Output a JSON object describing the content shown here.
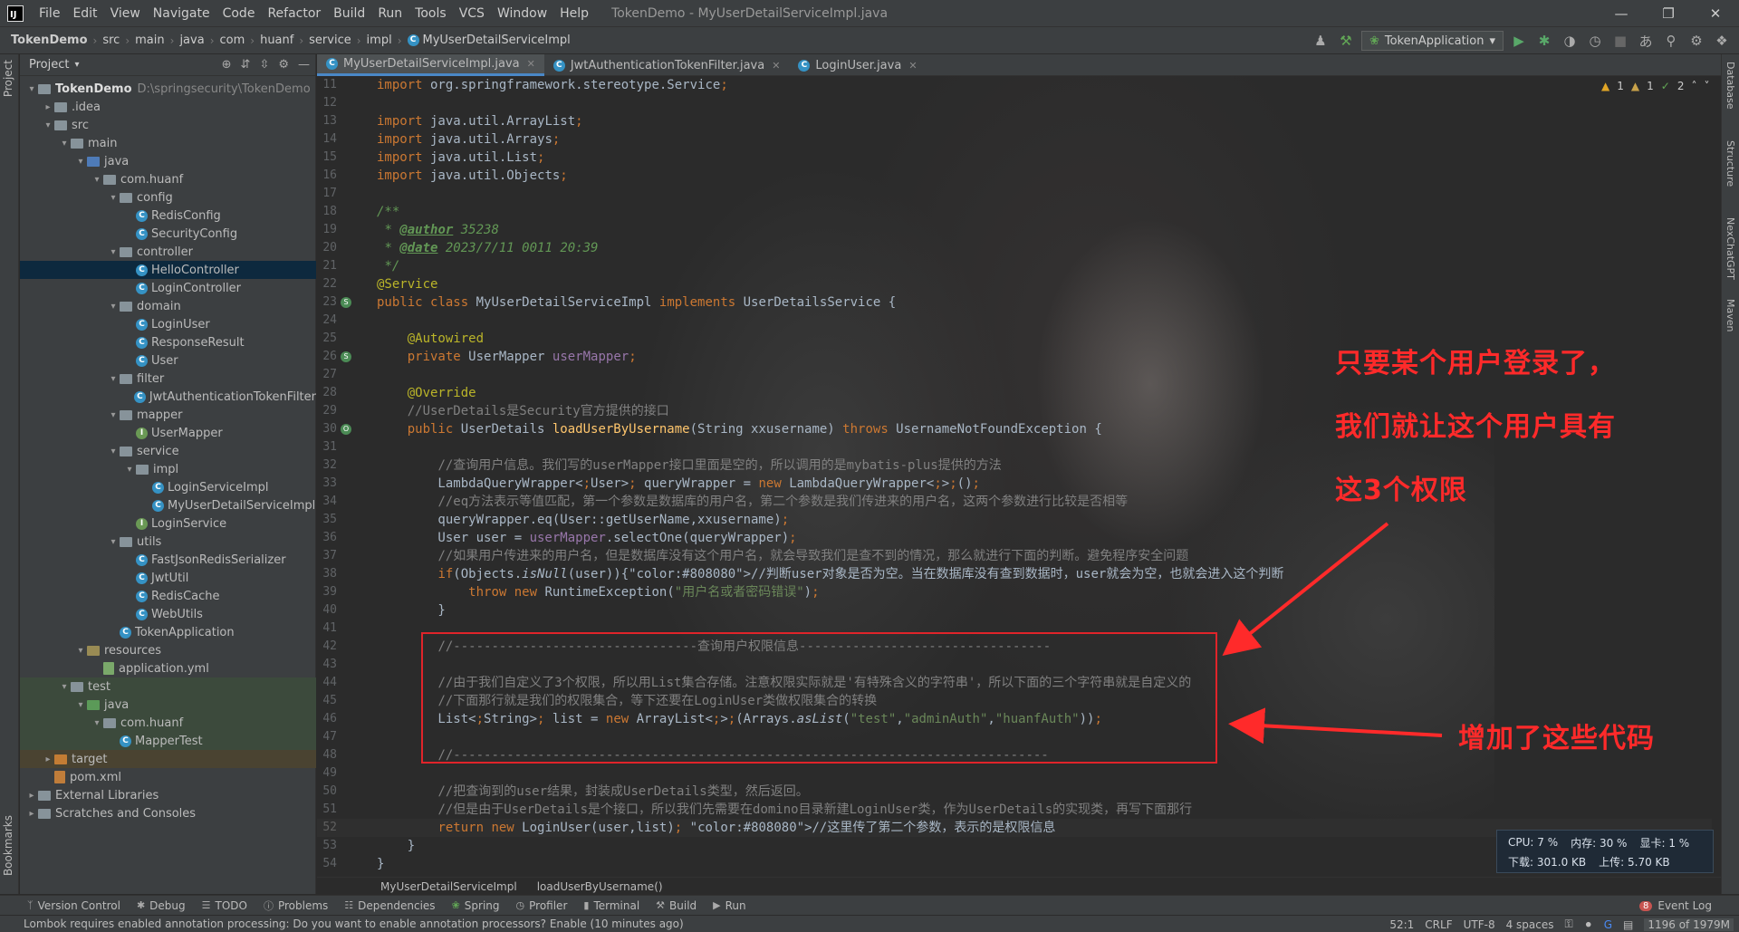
{
  "menubar": {
    "logo": "IJ",
    "items": [
      "File",
      "Edit",
      "View",
      "Navigate",
      "Code",
      "Refactor",
      "Build",
      "Run",
      "Tools",
      "VCS",
      "Window",
      "Help"
    ],
    "window_title": "TokenDemo - MyUserDetailServiceImpl.java"
  },
  "navbar": {
    "crumbs": [
      "TokenDemo",
      "src",
      "main",
      "java",
      "com",
      "huanf",
      "service",
      "impl",
      "MyUserDetailServiceImpl"
    ],
    "run_config": "TokenApplication"
  },
  "left_strip": {
    "project": "Project",
    "bookmarks": "Bookmarks"
  },
  "project_panel": {
    "title": "Project",
    "tree": [
      {
        "label": "TokenDemo",
        "path": "D:\\springsecurity\\TokenDemo"
      },
      {
        "label": ".idea"
      },
      {
        "label": "src"
      },
      {
        "label": "main"
      },
      {
        "label": "java"
      },
      {
        "label": "com.huanf"
      },
      {
        "label": "config"
      },
      {
        "label": "RedisConfig"
      },
      {
        "label": "SecurityConfig"
      },
      {
        "label": "controller"
      },
      {
        "label": "HelloController"
      },
      {
        "label": "LoginController"
      },
      {
        "label": "domain"
      },
      {
        "label": "LoginUser"
      },
      {
        "label": "ResponseResult"
      },
      {
        "label": "User"
      },
      {
        "label": "filter"
      },
      {
        "label": "JwtAuthenticationTokenFilter"
      },
      {
        "label": "mapper"
      },
      {
        "label": "UserMapper"
      },
      {
        "label": "service"
      },
      {
        "label": "impl"
      },
      {
        "label": "LoginServiceImpl"
      },
      {
        "label": "MyUserDetailServiceImpl"
      },
      {
        "label": "LoginService"
      },
      {
        "label": "utils"
      },
      {
        "label": "FastJsonRedisSerializer"
      },
      {
        "label": "JwtUtil"
      },
      {
        "label": "RedisCache"
      },
      {
        "label": "WebUtils"
      },
      {
        "label": "TokenApplication"
      },
      {
        "label": "resources"
      },
      {
        "label": "application.yml"
      },
      {
        "label": "test"
      },
      {
        "label": "java"
      },
      {
        "label": "com.huanf"
      },
      {
        "label": "MapperTest"
      },
      {
        "label": "target"
      },
      {
        "label": "pom.xml"
      },
      {
        "label": "External Libraries"
      },
      {
        "label": "Scratches and Consoles"
      }
    ]
  },
  "tabs": [
    {
      "label": "MyUserDetailServiceImpl.java",
      "active": true
    },
    {
      "label": "JwtAuthenticationTokenFilter.java",
      "active": false
    },
    {
      "label": "LoginUser.java",
      "active": false
    }
  ],
  "editor": {
    "inspections": {
      "warnings": "1",
      "weak": "1",
      "ok": "2"
    },
    "lines": [
      {
        "n": "11",
        "text": "import org.springframework.stereotype.Service;"
      },
      {
        "n": "12",
        "text": ""
      },
      {
        "n": "13",
        "text": "import java.util.ArrayList;"
      },
      {
        "n": "14",
        "text": "import java.util.Arrays;"
      },
      {
        "n": "15",
        "text": "import java.util.List;"
      },
      {
        "n": "16",
        "text": "import java.util.Objects;"
      },
      {
        "n": "17",
        "text": ""
      },
      {
        "n": "18",
        "text": "/**"
      },
      {
        "n": "19",
        "text": " * @author 35238"
      },
      {
        "n": "20",
        "text": " * @date 2023/7/11 0011 20:39"
      },
      {
        "n": "21",
        "text": " */"
      },
      {
        "n": "22",
        "text": "@Service"
      },
      {
        "n": "23",
        "text": "public class MyUserDetailServiceImpl implements UserDetailsService {"
      },
      {
        "n": "24",
        "text": ""
      },
      {
        "n": "25",
        "text": "    @Autowired"
      },
      {
        "n": "26",
        "text": "    private UserMapper userMapper;"
      },
      {
        "n": "27",
        "text": ""
      },
      {
        "n": "28",
        "text": "    @Override"
      },
      {
        "n": "29",
        "text": "    //UserDetails是Security官方提供的接口"
      },
      {
        "n": "30",
        "text": "    public UserDetails loadUserByUsername(String xxusername) throws UsernameNotFoundException {"
      },
      {
        "n": "31",
        "text": ""
      },
      {
        "n": "32",
        "text": "        //查询用户信息。我们写的userMapper接口里面是空的，所以调用的是mybatis-plus提供的方法"
      },
      {
        "n": "33",
        "text": "        LambdaQueryWrapper<User> queryWrapper = new LambdaQueryWrapper<>();"
      },
      {
        "n": "34",
        "text": "        //eq方法表示等值匹配，第一个参数是数据库的用户名，第二个参数是我们传进来的用户名，这两个参数进行比较是否相等"
      },
      {
        "n": "35",
        "text": "        queryWrapper.eq(User::getUserName,xxusername);"
      },
      {
        "n": "36",
        "text": "        User user = userMapper.selectOne(queryWrapper);"
      },
      {
        "n": "37",
        "text": "        //如果用户传进来的用户名，但是数据库没有这个用户名，就会导致我们是查不到的情况，那么就进行下面的判断。避免程序安全问题"
      },
      {
        "n": "38",
        "text": "        if(Objects.isNull(user)){//判断user对象是否为空。当在数据库没有查到数据时，user就会为空，也就会进入这个判断"
      },
      {
        "n": "39",
        "text": "            throw new RuntimeException(\"用户名或者密码错误\");"
      },
      {
        "n": "40",
        "text": "        }"
      },
      {
        "n": "41",
        "text": ""
      },
      {
        "n": "42",
        "text": "        //--------------------------------查询用户权限信息---------------------------------"
      },
      {
        "n": "43",
        "text": ""
      },
      {
        "n": "44",
        "text": "        //由于我们自定义了3个权限，所以用List集合存储。注意权限实际就是'有特殊含义的字符串'，所以下面的三个字符串就是自定义的"
      },
      {
        "n": "45",
        "text": "        //下面那行就是我们的权限集合，等下还要在LoginUser类做权限集合的转换"
      },
      {
        "n": "46",
        "text": "        List<String> list = new ArrayList<>(Arrays.asList(\"test\",\"adminAuth\",\"huanfAuth\"));"
      },
      {
        "n": "47",
        "text": ""
      },
      {
        "n": "48",
        "text": "        //------------------------------------------------------------------------------"
      },
      {
        "n": "49",
        "text": ""
      },
      {
        "n": "50",
        "text": "        //把查询到的user结果，封装成UserDetails类型，然后返回。"
      },
      {
        "n": "51",
        "text": "        //但是由于UserDetails是个接口，所以我们先需要在domino目录新建LoginUser类，作为UserDetails的实现类，再写下面那行"
      },
      {
        "n": "52",
        "text": "        return new LoginUser(user,list); //这里传了第二个参数，表示的是权限信息"
      },
      {
        "n": "53",
        "text": "    }"
      },
      {
        "n": "54",
        "text": "}"
      }
    ]
  },
  "annotations": {
    "line1": "只要某个用户登录了，",
    "line2": "我们就让这个用户具有",
    "line3": "这3个权限",
    "added": "增加了这些代码"
  },
  "editor_crumbs": [
    "MyUserDetailServiceImpl",
    "loadUserByUsername()"
  ],
  "right_strip": [
    "Database",
    "Structure",
    "NexChatGPT",
    "Maven"
  ],
  "monitor": {
    "cpu": "CPU: 7 %",
    "mem": "内存: 30 %",
    "gpu": "显卡: 1 %",
    "down": "下载: 301.0 KB",
    "up": "上传: 5.70 KB"
  },
  "tool_windows": [
    "Version Control",
    "Debug",
    "TODO",
    "Problems",
    "Dependencies",
    "Spring",
    "Profiler",
    "Terminal",
    "Build",
    "Run"
  ],
  "event_log": {
    "badge": "8",
    "label": "Event Log"
  },
  "statusbar": {
    "message": "Lombok requires enabled annotation processing: Do you want to enable annotation processors? Enable (10 minutes ago)",
    "position": "52:1",
    "line_sep": "CRLF",
    "encoding": "UTF-8",
    "indent": "4 spaces",
    "memory": "1196 of 1979M"
  }
}
